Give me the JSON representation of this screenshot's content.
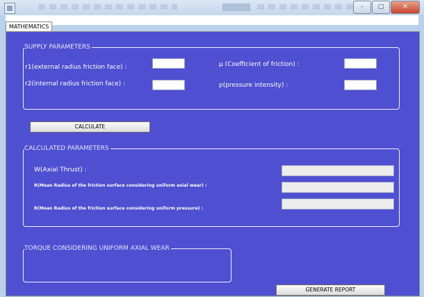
{
  "tab": {
    "label": "MATHEMATICS"
  },
  "supply": {
    "legend": "SUPPLY PARAMETERS",
    "r1_label": "r1(external radius friction face) :",
    "r2_label": "r2(internal radius friction face) :",
    "mu_label": "µ (Coefficient of friction) :",
    "p_label": "p(pressure intensity) :",
    "r1_value": "",
    "r2_value": "",
    "mu_value": "",
    "p_value": ""
  },
  "calculate_button": "CALCULATE",
  "calculated": {
    "legend": "CALCULATED PARAMETERS",
    "w_label": "W(Axial Thrust) :",
    "r_wear_label": "R(Mean Radius of the friction surface considering uniform axial wear) :",
    "r_pressure_label": "R(Mean Radius of the friction surface considering uniform pressure) :",
    "w_value": "",
    "r_wear_value": "",
    "r_pressure_value": ""
  },
  "torque": {
    "legend": "TORQUE CONSIDERING UNIFORM AXIAL WEAR"
  },
  "generate_button": "GENERATE REPORT",
  "window": {
    "minimize": "–",
    "maximize": "□",
    "close": "✕"
  },
  "colors": {
    "panel": "#4f4fd1",
    "text": "#ffffff"
  }
}
